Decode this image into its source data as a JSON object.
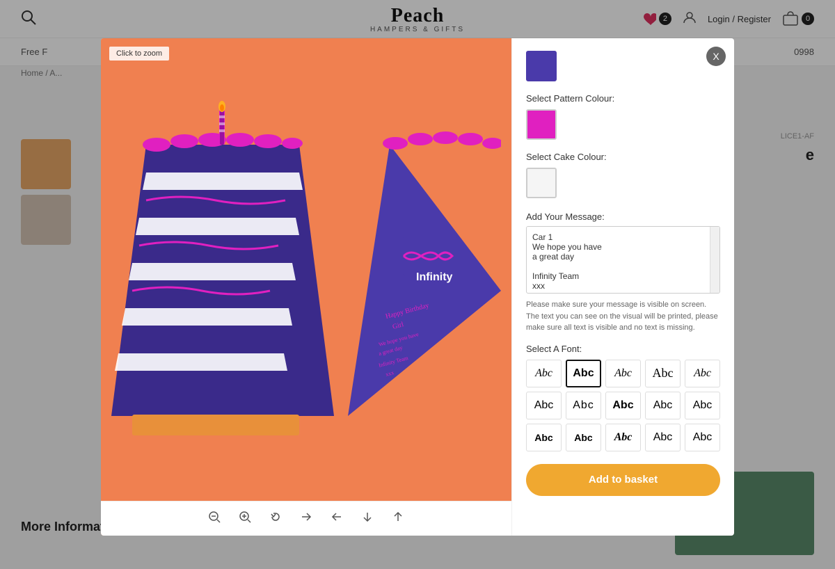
{
  "header": {
    "logo_main": "Peach",
    "logo_sub": "HAMPERS & GIFTS",
    "wishlist_count": "2",
    "login_label": "Login / Register",
    "cart_count": "0"
  },
  "nav": {
    "notice": "Free F",
    "phone": "0998"
  },
  "breadcrumb": "Home / A...",
  "background": {
    "sku": "LICE1-AF",
    "product_title": "e",
    "more_info": "More Information"
  },
  "modal": {
    "close_label": "X",
    "click_to_zoom": "Click to zoom",
    "pattern_colour_label": "Select Pattern Colour:",
    "cake_colour_label": "Select Cake Colour:",
    "message_label": "Add Your Message:",
    "message_content": "Car 1\nWe hope you have\na great day\n\nInfinity Team\nxxx",
    "message_note": "Please make sure your message is visible on screen. The text you can see on the visual will be printed, please make sure all text is visible and no text is missing.",
    "font_label": "Select A Font:",
    "fonts": [
      {
        "label": "Abc",
        "style": "script-italic",
        "id": "font-1"
      },
      {
        "label": "Abc",
        "style": "selected",
        "id": "font-2"
      },
      {
        "label": "Abc",
        "style": "normal-italic",
        "id": "font-3"
      },
      {
        "label": "Abc",
        "style": "script-fancy",
        "id": "font-4"
      },
      {
        "label": "Abc",
        "style": "serif-italic",
        "id": "font-5"
      },
      {
        "label": "Abc",
        "style": "sans",
        "id": "font-6"
      },
      {
        "label": "Abc",
        "style": "sans2",
        "id": "font-7"
      },
      {
        "label": "Abc",
        "style": "bold",
        "id": "font-8"
      },
      {
        "label": "Abc",
        "style": "sans3",
        "id": "font-9"
      },
      {
        "label": "Abc",
        "style": "sans4",
        "id": "font-10"
      },
      {
        "label": "Abc",
        "style": "impact",
        "id": "font-11"
      },
      {
        "label": "Abc",
        "style": "bold2",
        "id": "font-12"
      },
      {
        "label": "Abc",
        "style": "bold-italic",
        "id": "font-13"
      },
      {
        "label": "Abc",
        "style": "light",
        "id": "font-14"
      },
      {
        "label": "Abc",
        "style": "rounded",
        "id": "font-15"
      }
    ],
    "add_to_basket": "Add to basket",
    "toolbar_buttons": [
      "zoom-out",
      "zoom-in",
      "rotate",
      "arrow-right",
      "arrow-left",
      "arrow-down",
      "arrow-up"
    ],
    "colors": {
      "pattern_bg": "#4a3aaa",
      "pattern_swatch": "#e020c0",
      "cake_swatch": "#f0f0f0"
    },
    "candle_text": "Infinity",
    "card_text_1": "Happy Birthday",
    "card_text_2": "Girl",
    "card_text_3": "We hope you have",
    "card_text_4": "a great day",
    "card_text_5": "Infinity Team",
    "card_text_6": "xxx"
  }
}
